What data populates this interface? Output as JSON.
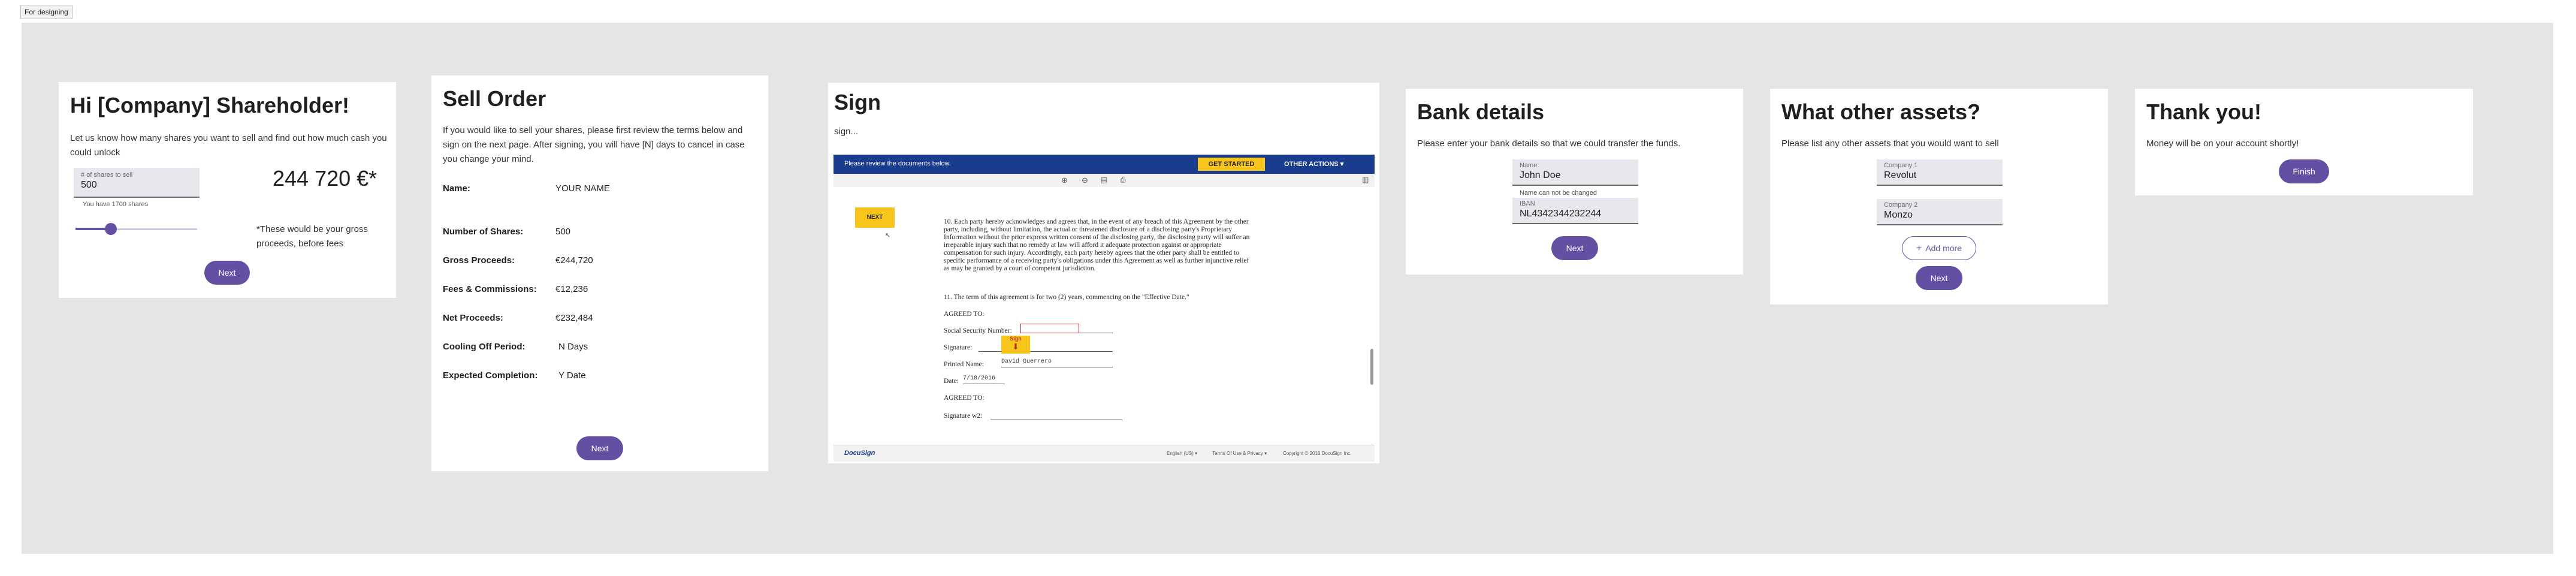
{
  "tag": "For designing",
  "card1": {
    "title": "Hi [Company] Shareholder!",
    "subtitle": "Let us know how many shares you want to sell and find out how much cash you could unlock",
    "field_label": "# of shares to sell",
    "field_value": "500",
    "helper": "You have 1700 shares",
    "amount": "244 720 €*",
    "footnote": "*These would be your gross proceeds, before fees",
    "slider_value": 0.29,
    "next": "Next"
  },
  "card2": {
    "title": "Sell Order",
    "intro": "If you would like to sell your shares, please first review the terms below and sign on the next page. After signing, you will have [N] days to cancel in case you change your mind.",
    "name_label": "Name:",
    "name_value": "YOUR NAME",
    "rows": [
      {
        "label": "Number of Shares:",
        "value": "500"
      },
      {
        "label": "Gross Proceeds:",
        "value": "€244,720"
      },
      {
        "label": "Fees & Commissions:",
        "value": "€12,236"
      },
      {
        "label": "Net Proceeds:",
        "value": "€232,484"
      },
      {
        "label": "Cooling Off Period:",
        "value": "N Days"
      },
      {
        "label": "Expected Completion:",
        "value": "Y Date"
      }
    ],
    "next": "Next"
  },
  "card3": {
    "title": "Sign",
    "subtitle": "sign...",
    "bar_text": "Please review the documents below.",
    "get_started": "GET STARTED",
    "other_actions": "OTHER ACTIONS ▾",
    "next_tag": "NEXT",
    "doc_para10": "10. Each party hereby acknowledges and agrees that, in the event of any breach of this Agreement by the other party, including, without limitation, the actual or threatened disclosure of a disclosing party's Proprietary Information without the prior express written consent of the disclosing party, the disclosing party will suffer an irreparable injury such that no remedy at law will afford it adequate protection against or appropriate compensation for such injury. Accordingly, each party hereby agrees that the other party shall be entitled to specific performance of a receiving party's obligations under this Agreement as well as further injunctive relief as may be granted by a court of competent jurisdiction.",
    "doc_para11": "11. The term of this agreement is for two (2) years, commencing on the \"Effective Date.\"",
    "agreed_to": "AGREED TO:",
    "ssn": "Social Security Number:",
    "signature": "Signature:",
    "sign_tag": "Sign",
    "printed_name": "Printed Name:",
    "printed_name_value": "David Guerrero",
    "date": "Date:",
    "date_value": "7/18/2016",
    "agreed_to_2": "AGREED TO:",
    "signature_2": "Signature w2:",
    "footer_logo": "DocuSign",
    "footer_lang": "English (US) ▾",
    "footer_terms": "Terms Of Use & Privacy ▾",
    "footer_copy": "Copyright © 2016 DocuSign Inc."
  },
  "card4": {
    "title": "Bank details",
    "subtitle": "Please enter your bank details so that we could transfer the funds.",
    "name_label": "Name:",
    "name_value": "John Doe",
    "name_helper": "Name can not be changed",
    "iban_label": "IBAN",
    "iban_value": "NL4342344232244",
    "next": "Next"
  },
  "card5": {
    "title": "What other assets?",
    "subtitle": "Please list any other assets that you would want to sell",
    "c1_label": "Company 1",
    "c1_value": "Revolut",
    "c2_label": "Company 2",
    "c2_value": "Monzo",
    "add_more": "Add more",
    "next": "Next"
  },
  "card6": {
    "title": "Thank you!",
    "subtitle": "Money will be on your account shortly!",
    "finish": "Finish"
  }
}
